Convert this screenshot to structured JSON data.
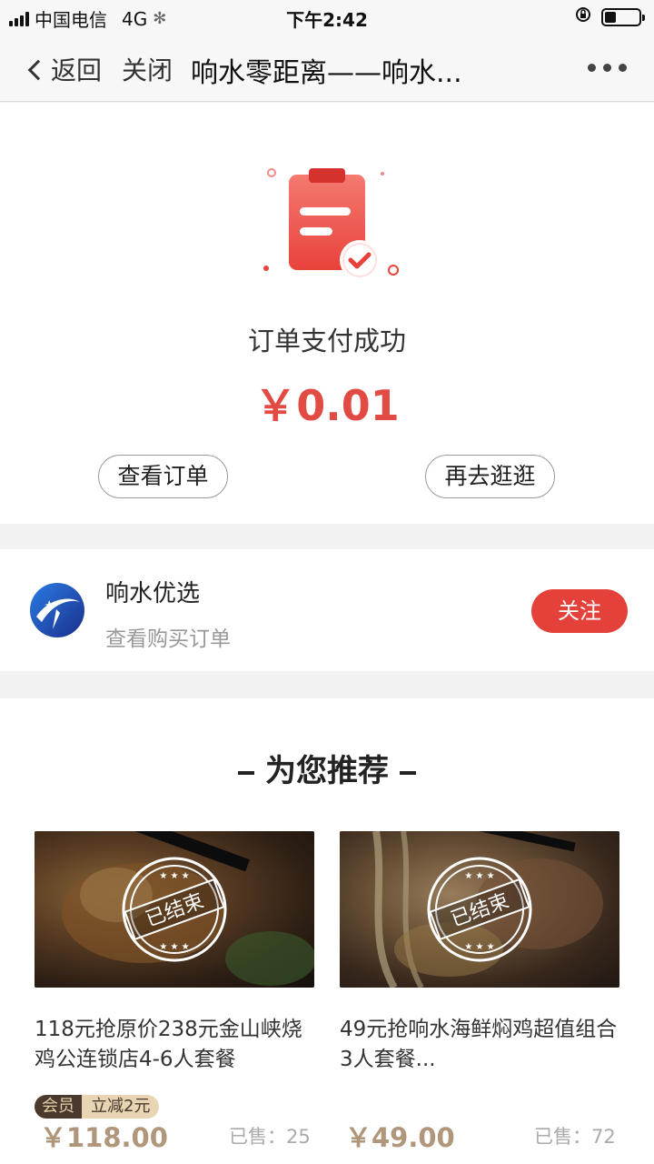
{
  "status_bar": {
    "carrier": "中国电信",
    "network": "4G",
    "time": "下午2:42"
  },
  "nav": {
    "back_label": "返回",
    "close_label": "关闭",
    "title": "响水零距离——响水..."
  },
  "payment": {
    "title": "订单支付成功",
    "amount": "￥0.01",
    "view_order_label": "查看订单",
    "shop_again_label": "再去逛逛"
  },
  "shop": {
    "name": "响水优选",
    "subtitle": "查看购买订单",
    "follow_label": "关注"
  },
  "recommend": {
    "title": "为您推荐",
    "products": [
      {
        "name": "118元抢原价238元金山峡烧鸡公连锁店4-6人套餐",
        "stamp": "已结束",
        "member_tag": "会员",
        "discount_tag": "立减2元",
        "price": "￥118.00",
        "sold": "已售：25"
      },
      {
        "name": "49元抢响水海鲜焖鸡超值组合3人套餐...",
        "stamp": "已结束",
        "price": "￥49.00",
        "sold": "已售：72"
      }
    ]
  },
  "colors": {
    "accent_red": "#e4413b",
    "price_gold": "#b0967a"
  }
}
